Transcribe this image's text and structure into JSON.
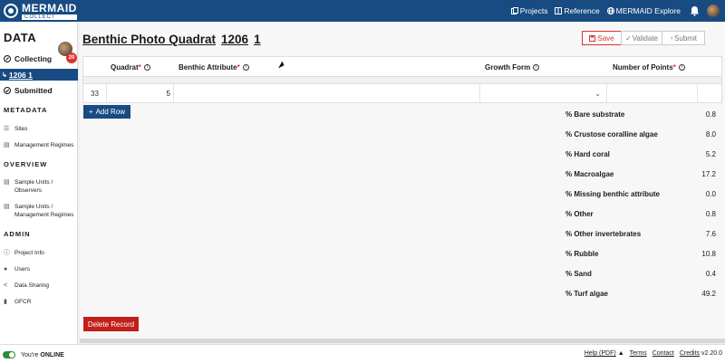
{
  "app": {
    "logo_title": "MERMAID",
    "logo_sub": "COLLECT"
  },
  "topnav": {
    "projects": "Projects",
    "reference": "Reference",
    "explore": "MERMAID Explore"
  },
  "sidebar": {
    "title": "DATA",
    "badge": "20",
    "collecting": "Collecting",
    "active_item": "1206 1",
    "submitted": "Submitted",
    "sections": [
      {
        "title": "METADATA",
        "links": [
          "Sites",
          "Management Regimes"
        ]
      },
      {
        "title": "OVERVIEW",
        "links": [
          "Sample Units / Observers",
          "Sample Units / Management Regimes"
        ]
      },
      {
        "title": "ADMIN",
        "links": [
          "Project Info",
          "Users",
          "Data Sharing",
          "GFCR"
        ]
      }
    ]
  },
  "page": {
    "title_prefix": "Benthic Photo Quadrat",
    "title_id": "1206",
    "title_num": "1"
  },
  "actions": {
    "save": "Save",
    "validate": "Validate",
    "submit": "Submit"
  },
  "table": {
    "headers": {
      "quadrat": "Quadrat",
      "benthic": "Benthic Attribute",
      "growth": "Growth Form",
      "points": "Number of Points"
    },
    "rows": [
      {
        "num": "33",
        "quadrat": "5",
        "attribute": "",
        "growth_form": "",
        "points": ""
      }
    ]
  },
  "buttons": {
    "add_row": "Add Row",
    "delete_record": "Delete Record"
  },
  "summary": [
    {
      "label": "% Bare substrate",
      "value": "0.8"
    },
    {
      "label": "% Crustose coralline algae",
      "value": "8.0"
    },
    {
      "label": "% Hard coral",
      "value": "5.2"
    },
    {
      "label": "% Macroalgae",
      "value": "17.2"
    },
    {
      "label": "% Missing benthic attribute",
      "value": "0.0"
    },
    {
      "label": "% Other",
      "value": "0.8"
    },
    {
      "label": "% Other invertebrates",
      "value": "7.6"
    },
    {
      "label": "% Rubble",
      "value": "10.8"
    },
    {
      "label": "% Sand",
      "value": "0.4"
    },
    {
      "label": "% Turf algae",
      "value": "49.2"
    }
  ],
  "footer": {
    "status_prefix": "You're",
    "status": "ONLINE",
    "help": "Help (PDF)",
    "terms": "Terms",
    "contact": "Contact",
    "credits": "Credits",
    "version": "v2.20.0"
  }
}
